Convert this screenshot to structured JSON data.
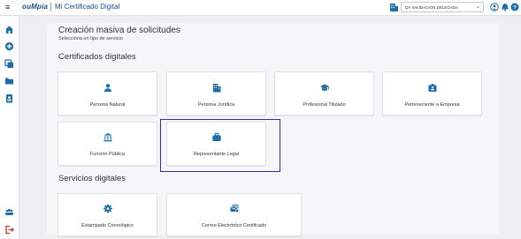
{
  "header": {
    "menu_glyph": "≡",
    "logo_text": "ouMpia",
    "app_title": "Mi Certificado Digital",
    "account_select": {
      "value": "QA VALIDACION DELEGADA",
      "chevron": "⌄"
    },
    "icons": [
      "building-icon",
      "user-circle-icon",
      "bell-icon",
      "help-icon"
    ]
  },
  "sidebar": {
    "items": [
      "home-icon",
      "add-circle-icon",
      "layers-icon",
      "folder-icon",
      "badge-icon"
    ],
    "bottom": [
      "group-icon",
      "logout-icon"
    ]
  },
  "page": {
    "title": "Creación masiva de solicitudes",
    "subtitle": "Selecciona un tipo de servicio"
  },
  "sections": {
    "certificados": {
      "title": "Certificados digitales",
      "cards": [
        {
          "label": "Persona Natural",
          "icon": "person-icon"
        },
        {
          "label": "Persona Jurídica",
          "icon": "office-building-icon"
        },
        {
          "label": "Profesional Titulado",
          "icon": "graduation-cap-icon"
        },
        {
          "label": "Perteneciente a Empresa",
          "icon": "id-card-icon"
        },
        {
          "label": "Función Pública",
          "icon": "institution-icon"
        },
        {
          "label": "Representante Legal",
          "icon": "briefcase-icon"
        }
      ]
    },
    "servicios": {
      "title": "Servicios digitales",
      "cards": [
        {
          "label": "Estampado Cronológico",
          "icon": "gear-icon"
        },
        {
          "label": "Correo Electrónico Certificado",
          "icon": "mail-certificate-icon"
        }
      ]
    }
  },
  "colors": {
    "accent": "#1c6ea8",
    "brand": "#15508f",
    "highlight": "#2b2fb0"
  }
}
